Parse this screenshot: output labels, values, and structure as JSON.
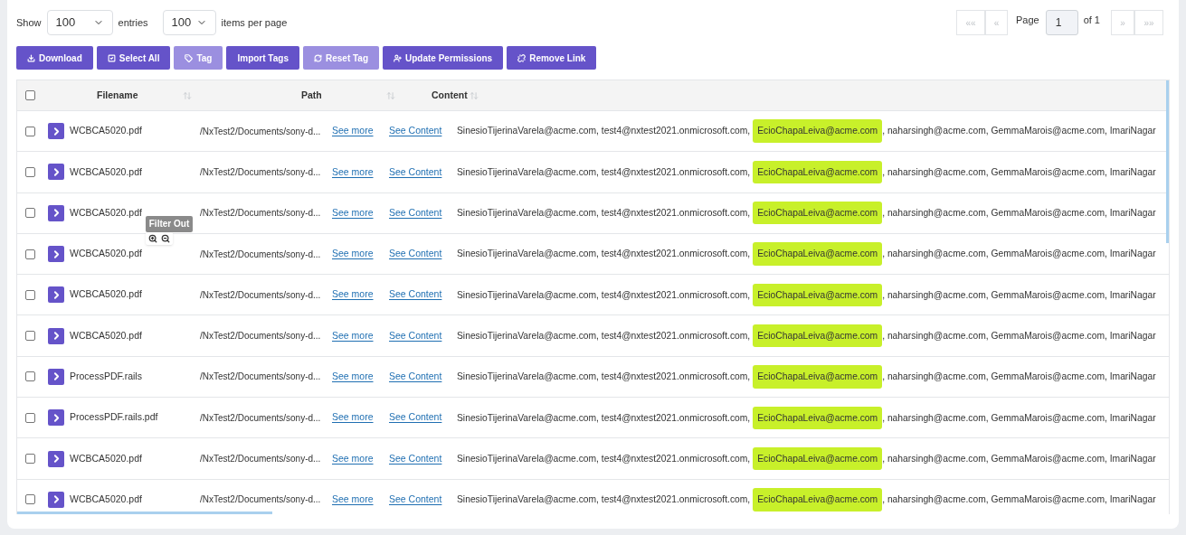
{
  "controls": {
    "show_label": "Show",
    "entries_select": "100",
    "entries_label": "entries",
    "per_page_select": "100",
    "per_page_label": "items per page"
  },
  "pagination": {
    "first": "««",
    "prev": "«",
    "page_label": "Page",
    "page": "1",
    "of_label": "of 1",
    "next": "»",
    "last": "»»"
  },
  "actions": [
    {
      "label": "Download",
      "disabled": false
    },
    {
      "label": "Select All",
      "disabled": false
    },
    {
      "label": "Tag",
      "disabled": true
    },
    {
      "label": "Import Tags",
      "disabled": false
    },
    {
      "label": "Reset Tag",
      "disabled": true
    },
    {
      "label": "Update Permissions",
      "disabled": false
    },
    {
      "label": "Remove Link",
      "disabled": false
    }
  ],
  "table": {
    "select_all_checked": false,
    "columns": [
      {
        "label": "Filename"
      },
      {
        "label": "Path"
      },
      {
        "label": "Content"
      }
    ],
    "rows": [
      {
        "checked": false,
        "filename": "WCBCA5020.pdf",
        "path": "/NxTest2/Documents/sony-d...",
        "see_more": "See more",
        "see_content": "See Content",
        "content_before": "SinesioTijerinaVarela@acme.com, test4@nxtest2021.onmicrosoft.com,",
        "content_highlight": "EcioChapaLeiva@acme.com",
        "content_after": ", naharsingh@acme.com, GemmaMarois@acme.com, ImariNagar"
      },
      {
        "checked": false,
        "filename": "WCBCA5020.pdf",
        "path": "/NxTest2/Documents/sony-d...",
        "see_more": "See more",
        "see_content": "See Content",
        "content_before": "SinesioTijerinaVarela@acme.com, test4@nxtest2021.onmicrosoft.com,",
        "content_highlight": "EcioChapaLeiva@acme.com",
        "content_after": ", naharsingh@acme.com, GemmaMarois@acme.com, ImariNagar"
      },
      {
        "checked": false,
        "filename": "WCBCA5020.pdf",
        "path": "/NxTest2/Documents/sony-d...",
        "see_more": "See more",
        "see_content": "See Content",
        "content_before": "SinesioTijerinaVarela@acme.com, test4@nxtest2021.onmicrosoft.com,",
        "content_highlight": "EcioChapaLeiva@acme.com",
        "content_after": ", naharsingh@acme.com, GemmaMarois@acme.com, ImariNagar"
      },
      {
        "checked": false,
        "filename": "WCBCA5020.pdf",
        "path": "/NxTest2/Documents/sony-d...",
        "see_more": "See more",
        "see_content": "See Content",
        "content_before": "SinesioTijerinaVarela@acme.com, test4@nxtest2021.onmicrosoft.com,",
        "content_highlight": "EcioChapaLeiva@acme.com",
        "content_after": ", naharsingh@acme.com, GemmaMarois@acme.com, ImariNagar"
      },
      {
        "checked": false,
        "filename": "WCBCA5020.pdf",
        "path": "/NxTest2/Documents/sony-d...",
        "see_more": "See more",
        "see_content": "See Content",
        "content_before": "SinesioTijerinaVarela@acme.com, test4@nxtest2021.onmicrosoft.com,",
        "content_highlight": "EcioChapaLeiva@acme.com",
        "content_after": ", naharsingh@acme.com, GemmaMarois@acme.com, ImariNagar"
      },
      {
        "checked": false,
        "filename": "WCBCA5020.pdf",
        "path": "/NxTest2/Documents/sony-d...",
        "see_more": "See more",
        "see_content": "See Content",
        "content_before": "SinesioTijerinaVarela@acme.com, test4@nxtest2021.onmicrosoft.com,",
        "content_highlight": "EcioChapaLeiva@acme.com",
        "content_after": ", naharsingh@acme.com, GemmaMarois@acme.com, ImariNagar"
      },
      {
        "checked": false,
        "filename": "ProcessPDF.rails",
        "path": "/NxTest2/Documents/sony-d...",
        "see_more": "See more",
        "see_content": "See Content",
        "content_before": "SinesioTijerinaVarela@acme.com, test4@nxtest2021.onmicrosoft.com,",
        "content_highlight": "EcioChapaLeiva@acme.com",
        "content_after": ", naharsingh@acme.com, GemmaMarois@acme.com, ImariNagar"
      },
      {
        "checked": false,
        "filename": "ProcessPDF.rails.pdf",
        "path": "/NxTest2/Documents/sony-d...",
        "see_more": "See more",
        "see_content": "See Content",
        "content_before": "SinesioTijerinaVarela@acme.com, test4@nxtest2021.onmicrosoft.com,",
        "content_highlight": "EcioChapaLeiva@acme.com",
        "content_after": ", naharsingh@acme.com, GemmaMarois@acme.com, ImariNagar"
      },
      {
        "checked": false,
        "filename": "WCBCA5020.pdf",
        "path": "/NxTest2/Documents/sony-d...",
        "see_more": "See more",
        "see_content": "See Content",
        "content_before": "SinesioTijerinaVarela@acme.com, test4@nxtest2021.onmicrosoft.com,",
        "content_highlight": "EcioChapaLeiva@acme.com",
        "content_after": ", naharsingh@acme.com, GemmaMarois@acme.com, ImariNagar"
      },
      {
        "checked": false,
        "filename": "WCBCA5020.pdf",
        "path": "/NxTest2/Documents/sony-d...",
        "see_more": "See more",
        "see_content": "See Content",
        "content_before": "SinesioTijerinaVarela@acme.com, test4@nxtest2021.onmicrosoft.com,",
        "content_highlight": "EcioChapaLeiva@acme.com",
        "content_after": ", naharsingh@acme.com, GemmaMarois@acme.com, ImariNagar"
      }
    ]
  },
  "tooltip": {
    "text": "Filter Out"
  }
}
